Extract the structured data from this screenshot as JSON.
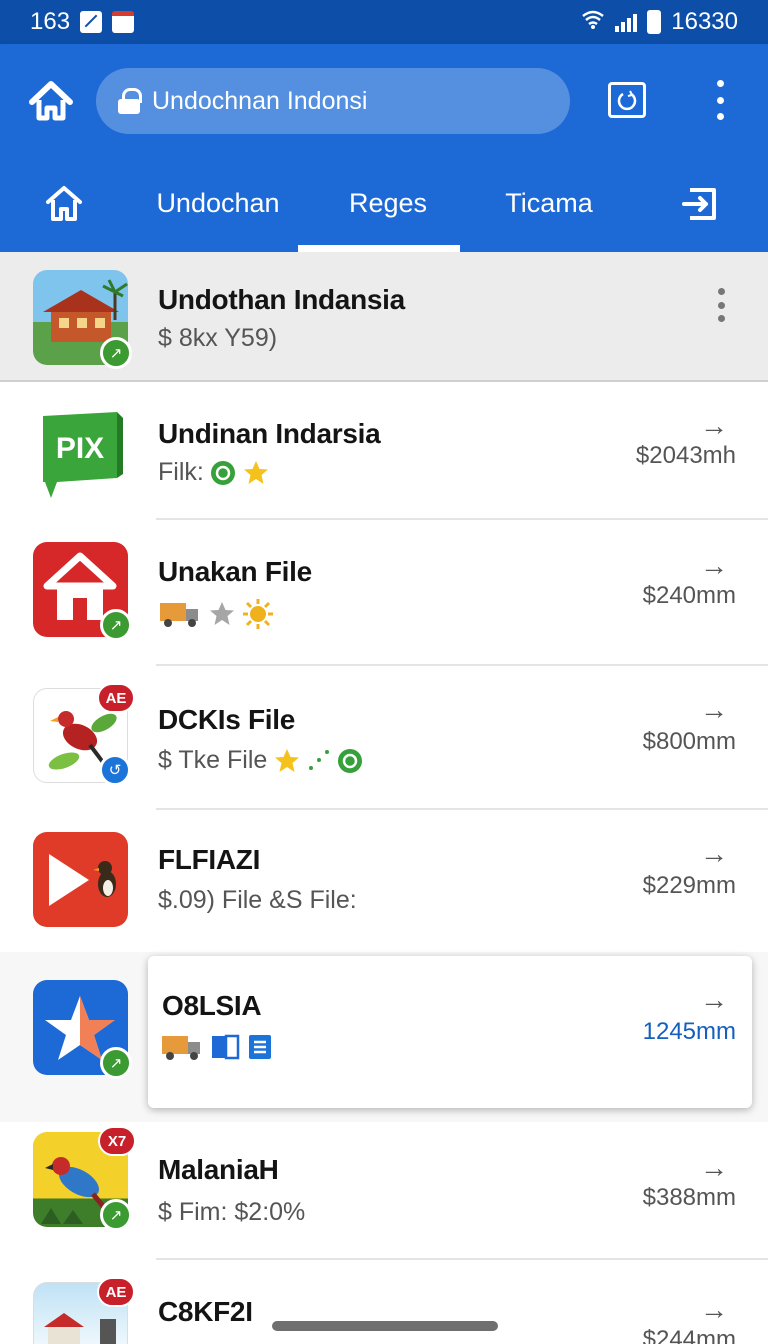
{
  "status_bar": {
    "left_text": "163",
    "right_text": "16330"
  },
  "app_bar": {
    "search_text": "Undochnan Indonsi",
    "tabs": [
      {
        "label": "Undochan"
      },
      {
        "label": "Reges",
        "selected": true
      },
      {
        "label": "Ticama"
      }
    ]
  },
  "list": [
    {
      "title": "Undothan Indansia",
      "subtitle": "$ 8kx Y59)",
      "price": "",
      "icon": "house-icon"
    },
    {
      "title": "Undinan Indarsia",
      "subtitle": "Filk:",
      "price": "$2043mh",
      "icon": "pix-icon"
    },
    {
      "title": "Unakan File",
      "subtitle": "",
      "price": "$240mm",
      "icon": "home-red-icon"
    },
    {
      "title": "DCKIs File",
      "subtitle": "$ Tke File",
      "price": "$800mm",
      "icon": "bird-icon",
      "badge": "AE"
    },
    {
      "title": "FLFIAZI",
      "subtitle": "$.09) File &S File:",
      "price": "$229mm",
      "icon": "play-icon"
    },
    {
      "title": "O8LSIA",
      "subtitle": "",
      "price": "1245mm",
      "icon": "star-app-icon",
      "price_color": "#1560bf"
    },
    {
      "title": "MalaniaH",
      "subtitle": "$ Fim: $2:0%",
      "price": "$388mm",
      "icon": "parrot-icon",
      "badge": "X7"
    },
    {
      "title": "C8KF2I",
      "subtitle": "",
      "price": "$244mm",
      "icon": "village-icon",
      "badge": "AE"
    }
  ],
  "colors": {
    "app_bar": "#1d6ad6",
    "status_bar": "#0d4fa8",
    "accent_price": "#1560bf"
  }
}
